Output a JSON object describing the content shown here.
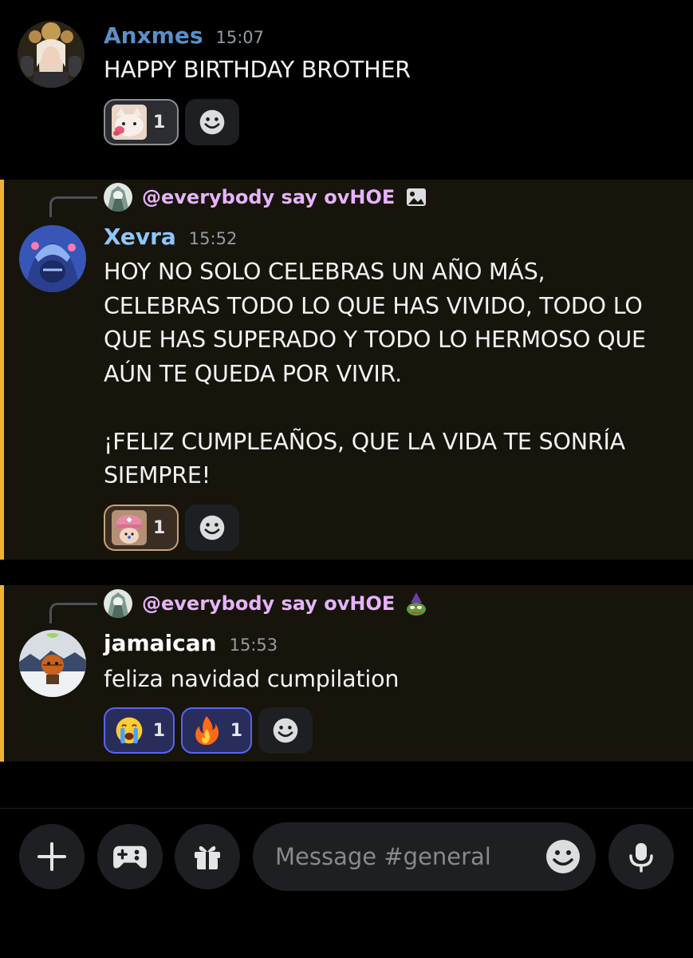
{
  "messages": [
    {
      "username": "Anxmes",
      "username_color": "#5b8fc7",
      "time": "15:07",
      "text": "HAPPY BIRTHDAY BROTHER",
      "reactions": [
        {
          "emoji": "cat-kiss-emoji",
          "count": "1"
        }
      ]
    },
    {
      "reply_to": "@everybody say ovHOE",
      "reply_icon": "image-icon",
      "username": "Xevra",
      "username_color": "#8ec6ff",
      "time": "15:52",
      "text": "HOY NO SOLO CELEBRAS UN AÑO MÁS,\nCELEBRAS TODO LO QUE HAS VIVIDO, TODO LO\nQUE HAS SUPERADO Y TODO LO HERMOSO QUE\nAÚN TE QUEDA POR VIVIR.\n\n¡FELIZ CUMPLEAÑOS, QUE LA VIDA TE SONRÍA\nSIEMPRE!",
      "reactions": [
        {
          "emoji": "chopper-emoji",
          "count": "1"
        }
      ]
    },
    {
      "reply_to": "@everybody say ovHOE",
      "reply_icon": "pepe-emoji",
      "username": "jamaican",
      "username_color": "#ffffff",
      "time": "15:53",
      "text": "feliza navidad cumpilation",
      "reactions": [
        {
          "emoji": "crying-face-emoji",
          "count": "1"
        },
        {
          "emoji": "fire-emoji",
          "count": "1"
        }
      ]
    }
  ],
  "composer": {
    "placeholder": "Message #general",
    "buttons": [
      "plus-icon",
      "gamepad-icon",
      "gift-icon",
      "emoji-icon",
      "microphone-icon"
    ]
  },
  "colors": {
    "highlight_bg": "#17140c",
    "highlight_bar": "#f0b232",
    "reply_name": "#e6b3ff",
    "reaction_active_border": "#5865f2"
  }
}
